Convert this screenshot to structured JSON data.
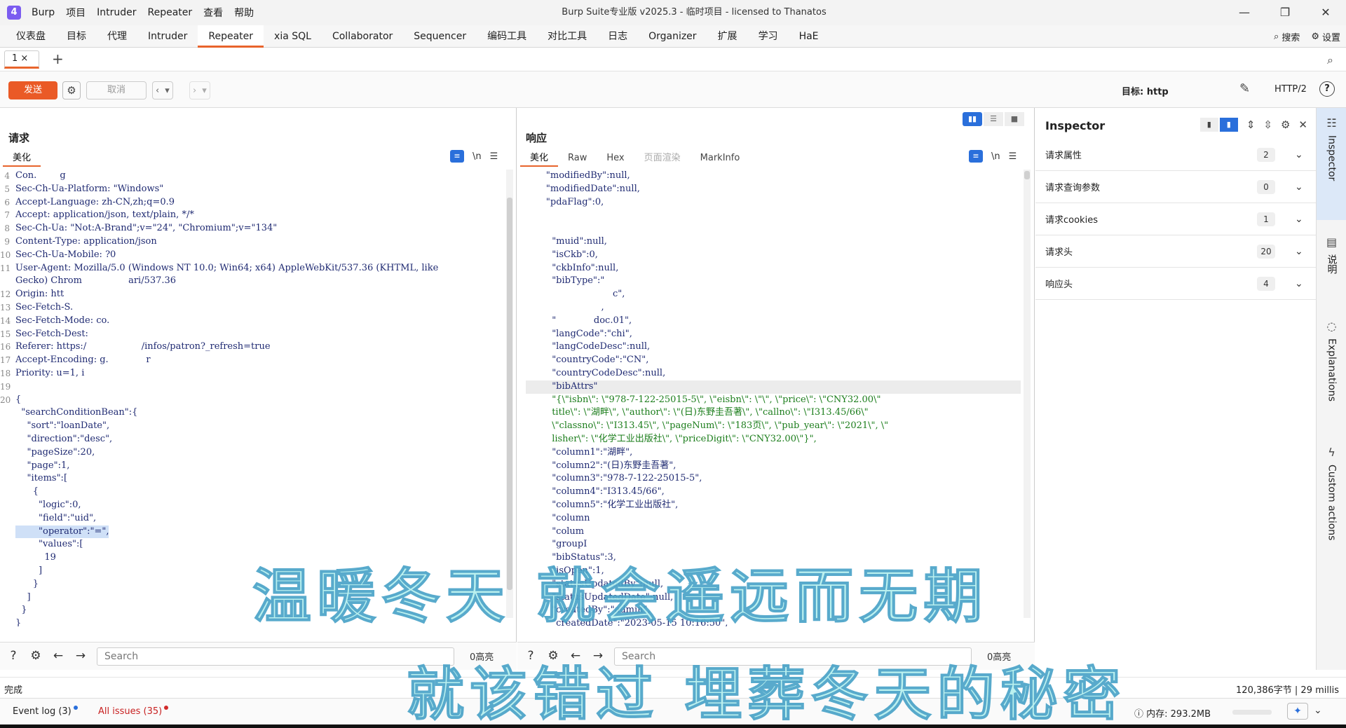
{
  "titlebar": {
    "logo": "4",
    "menus": [
      "Burp",
      "项目",
      "Intruder",
      "Repeater",
      "查看",
      "帮助"
    ],
    "window_title": "Burp Suite专业版 v2025.3 - 临时项目 - licensed to Thanatos",
    "buttons": [
      "—",
      "❐",
      "✕"
    ]
  },
  "nav": {
    "tabs": [
      "仪表盘",
      "目标",
      "代理",
      "Intruder",
      "Repeater",
      "xia SQL",
      "Collaborator",
      "Sequencer",
      "编码工具",
      "对比工具",
      "日志",
      "Organizer",
      "扩展",
      "学习",
      "HaE"
    ],
    "active": "Repeater",
    "search_label": "搜索",
    "settings_label": "设置"
  },
  "repeater_tabs": {
    "tab_label": "1 ×",
    "add": "+"
  },
  "toolbar": {
    "send": "发送",
    "cancel": "取消",
    "target_label": "目标: http",
    "http_version": "HTTP/2",
    "help": "?"
  },
  "request": {
    "title": "请求",
    "subtab": "美化",
    "lines": [
      {
        "n": "4",
        "t": "Con.        g"
      },
      {
        "n": "5",
        "t": "Sec-Ch-Ua-Platform: \"Windows\""
      },
      {
        "n": "6",
        "t": "Accept-Language: zh-CN,zh;q=0.9"
      },
      {
        "n": "7",
        "t": "Accept: application/json, text/plain, */*"
      },
      {
        "n": "8",
        "t": "Sec-Ch-Ua: \"Not:A-Brand\";v=\"24\", \"Chromium\";v=\"134\""
      },
      {
        "n": "9",
        "t": "Content-Type: application/json"
      },
      {
        "n": "10",
        "t": "Sec-Ch-Ua-Mobile: ?0"
      },
      {
        "n": "11",
        "t": "User-Agent: Mozilla/5.0 (Windows NT 10.0; Win64; x64) AppleWebKit/537.36 (KHTML, like"
      },
      {
        "n": "",
        "t": "Gecko) Chrom                ari/537.36"
      },
      {
        "n": "12",
        "t": "Origin: htt"
      },
      {
        "n": "13",
        "t": "Sec-Fetch-S."
      },
      {
        "n": "14",
        "t": "Sec-Fetch-Mode: co."
      },
      {
        "n": "15",
        "t": "Sec-Fetch-Dest:"
      },
      {
        "n": "16",
        "t": "Referer: https:/                   /infos/patron?_refresh=true"
      },
      {
        "n": "17",
        "t": "Accept-Encoding: g.             r"
      },
      {
        "n": "18",
        "t": "Priority: u=1, i"
      },
      {
        "n": "19",
        "t": ""
      },
      {
        "n": "20",
        "t": "{"
      },
      {
        "n": "",
        "t": "  \"searchConditionBean\":{"
      },
      {
        "n": "",
        "t": "    \"sort\":\"loanDate\","
      },
      {
        "n": "",
        "t": "    \"direction\":\"desc\","
      },
      {
        "n": "",
        "t": "    \"pageSize\":20,"
      },
      {
        "n": "",
        "t": "    \"page\":1,"
      },
      {
        "n": "",
        "t": "    \"items\":["
      },
      {
        "n": "",
        "t": "      {"
      },
      {
        "n": "",
        "t": "        \"logic\":0,"
      },
      {
        "n": "",
        "t": "        \"field\":\"uid\","
      },
      {
        "n": "",
        "t": "        \"operator\":\"=\","
      },
      {
        "n": "",
        "t": "        \"values\":["
      },
      {
        "n": "",
        "t": "          19"
      },
      {
        "n": "",
        "t": "        ]"
      },
      {
        "n": "",
        "t": "      }"
      },
      {
        "n": "",
        "t": "    ]"
      },
      {
        "n": "",
        "t": "  }"
      },
      {
        "n": "",
        "t": "}"
      }
    ]
  },
  "response": {
    "title": "响应",
    "subtabs": [
      "美化",
      "Raw",
      "Hex",
      "页面渲染",
      "MarkInfo"
    ],
    "lines": [
      "       \"modifiedBy\":null,",
      "       \"modifiedDate\":null,",
      "       \"pdaFlag\":0,",
      "",
      "",
      "         \"muid\":null,",
      "         \"isCkb\":0,",
      "         \"ckbInfo\":null,",
      "         \"bibType\":\"",
      "                              c\",",
      "                          ,",
      "         \"             doc.01\",",
      "         \"langCode\":\"chi\",",
      "         \"langCodeDesc\":null,",
      "         \"countryCode\":\"CN\",",
      "         \"countryCodeDesc\":null,",
      "         \"bibAttrs\"",
      "         \"{\\\"isbn\\\": \\\"978-7-122-25015-5\\\", \\\"eisbn\\\": \\\"\\\", \\\"price\\\": \\\"CNY32.00\\\"",
      "         title\\\": \\\"湖畔\\\", \\\"author\\\": \\\"(日)东野圭吾著\\\", \\\"callno\\\": \\\"I313.45/66\\\"",
      "         \\\"classno\\\": \\\"I313.45\\\", \\\"pageNum\\\": \\\"183页\\\", \\\"pub_year\\\": \\\"2021\\\", \\\"",
      "         lisher\\\": \\\"化学工业出版社\\\", \\\"priceDigit\\\": \\\"CNY32.00\\\"}\",",
      "         \"column1\":\"湖畔\",",
      "         \"column2\":\"(日)东野圭吾著\",",
      "         \"column3\":\"978-7-122-25015-5\",",
      "         \"column4\":\"I313.45/66\",",
      "         \"column5\":\"化学工业出版社\",",
      "         \"column",
      "         \"colum",
      "         \"groupI",
      "         \"bibStatus\":3,",
      "         \"isOpen\":1,",
      "         \"statusUpdatedBy\":null,",
      "         \"statusUpdatedDate\":null,",
      "         \"createdBy\":\"admin\",",
      "         \"createdDate\":\"2023-05-15 10:16:50\","
    ]
  },
  "search": {
    "placeholder": "Search",
    "count_req": "0高亮",
    "count_res": "0高亮"
  },
  "inspector": {
    "title": "Inspector",
    "rows": [
      {
        "label": "请求属性",
        "count": "2"
      },
      {
        "label": "请求查询参数",
        "count": "0"
      },
      {
        "label": "请求cookies",
        "count": "1"
      },
      {
        "label": "请求头",
        "count": "20"
      },
      {
        "label": "响应头",
        "count": "4"
      }
    ]
  },
  "rail": [
    "Inspector",
    "说明",
    "Explanations",
    "Custom actions"
  ],
  "status": {
    "left": "完成",
    "right": "120,386字节 | 29 millis"
  },
  "footer": {
    "event_log": "Event log (3)",
    "issues": "All issues (35)",
    "memory": "内存: 293.2MB"
  },
  "overlay": {
    "line1": "温暖冬天 就会遥远而无期",
    "line2": "就该错过 埋葬冬天的秘密"
  },
  "colors": {
    "accent": "#e8642c",
    "send": "#ea5a26",
    "blue": "#2a6fdb",
    "string_green": "#1b7d1b"
  }
}
